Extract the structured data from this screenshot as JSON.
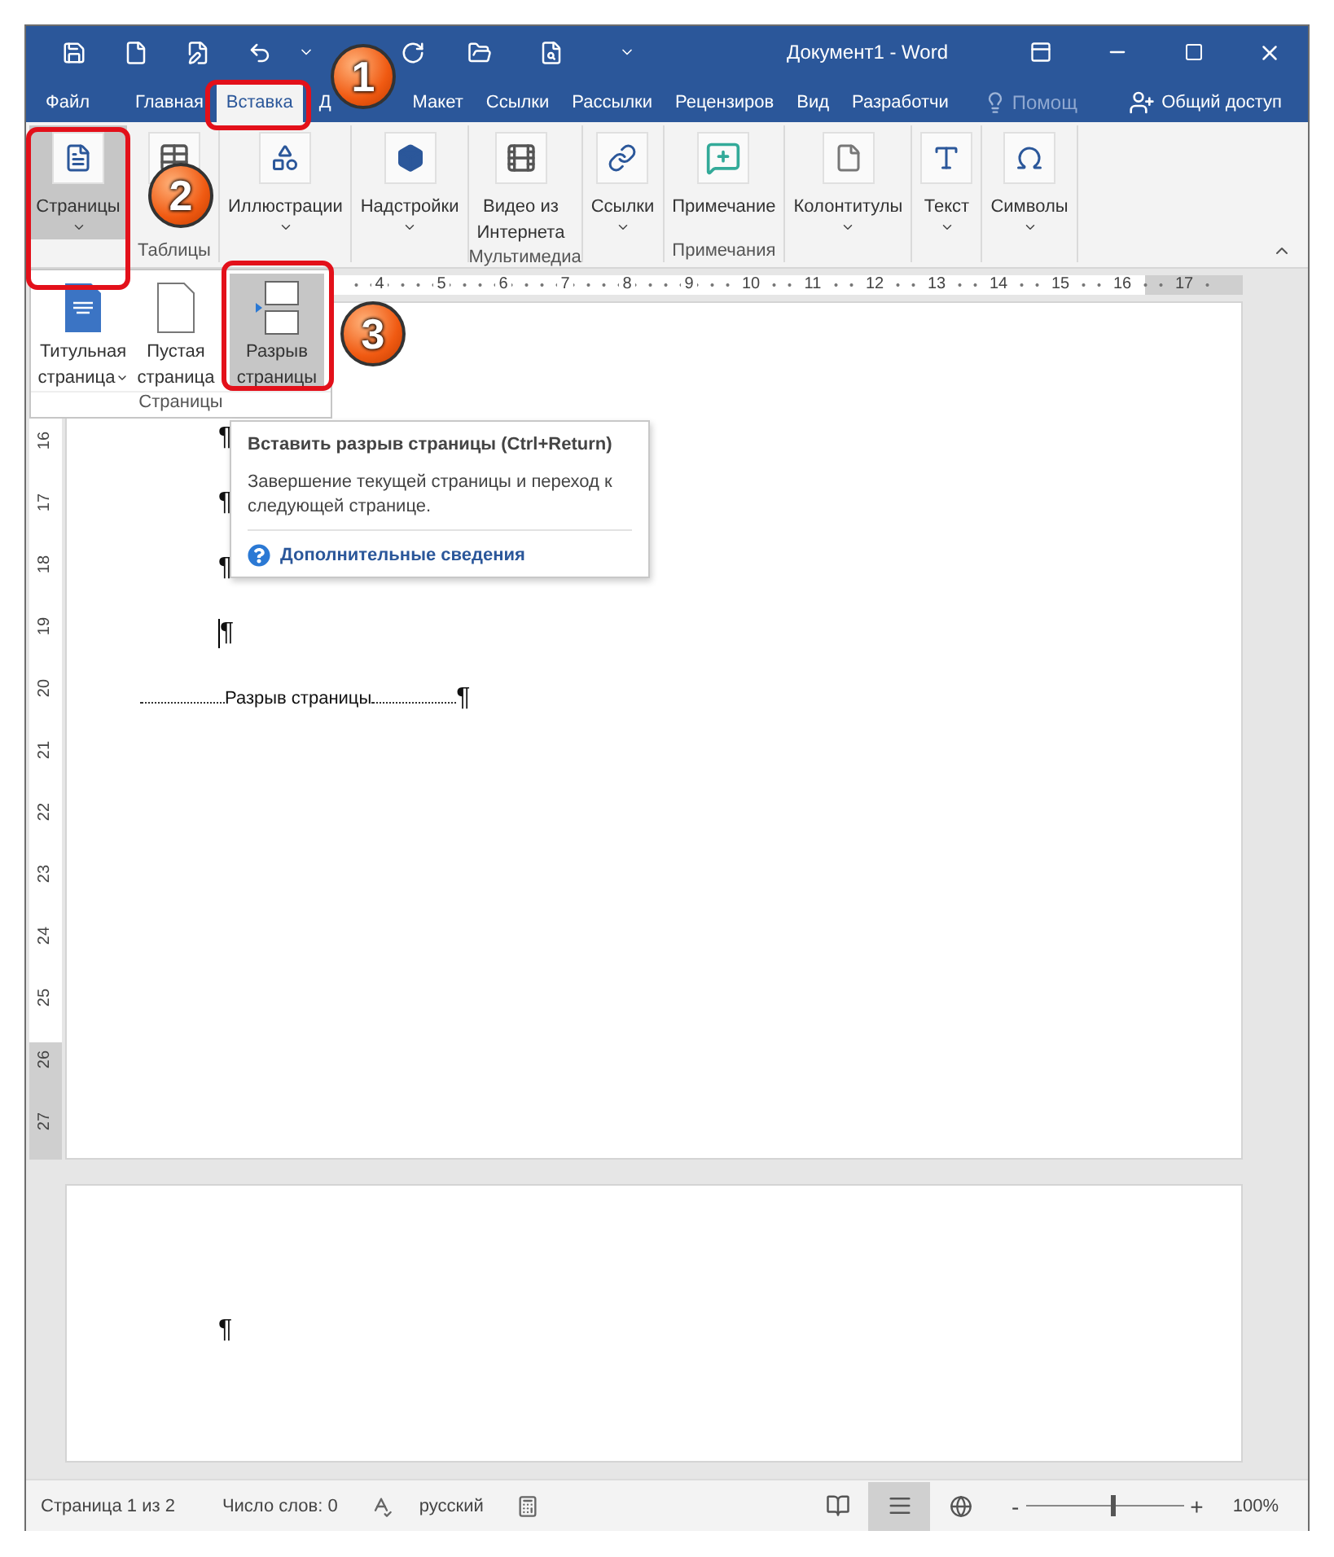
{
  "window": {
    "title": "Документ1 - Word"
  },
  "tabs": [
    {
      "label": "Файл",
      "selected": false
    },
    {
      "label": "Главная",
      "selected": false
    },
    {
      "label": "Вставка",
      "selected": true
    },
    {
      "label": "Д",
      "selected": false
    },
    {
      "label": "Макет",
      "selected": false
    },
    {
      "label": "Ссылки",
      "selected": false
    },
    {
      "label": "Рассылки",
      "selected": false
    },
    {
      "label": "Рецензиров",
      "selected": false
    },
    {
      "label": "Вид",
      "selected": false
    },
    {
      "label": "Разработчи",
      "selected": false
    }
  ],
  "tell_me": {
    "placeholder": "Помощ"
  },
  "share_button": {
    "label": "Общий доступ"
  },
  "ribbon": {
    "groups": [
      {
        "buttons": [
          {
            "kind": "pages",
            "lines": [
              "Страницы"
            ],
            "dropdown": true,
            "pressed": true
          }
        ]
      },
      {
        "label": "Таблицы",
        "buttons": [
          {
            "kind": "table",
            "dropdown": false,
            "pressed": false
          }
        ]
      },
      {
        "buttons": [
          {
            "kind": "illustrations",
            "lines": [
              "Иллюстрации"
            ],
            "dropdown": true,
            "pressed": false
          }
        ]
      },
      {
        "buttons": [
          {
            "kind": "addins",
            "lines": [
              "Надстройки"
            ],
            "dropdown": true,
            "pressed": false
          }
        ]
      },
      {
        "label": "Мультимедиа",
        "buttons": [
          {
            "kind": "video",
            "lines": [
              "Видео из",
              "Интернета"
            ],
            "dropdown": false,
            "pressed": false
          }
        ]
      },
      {
        "buttons": [
          {
            "kind": "links",
            "lines": [
              "Ссылки"
            ],
            "dropdown": true,
            "pressed": false
          }
        ]
      },
      {
        "label": "Примечания",
        "buttons": [
          {
            "kind": "comment",
            "lines": [
              "Примечание"
            ],
            "dropdown": false,
            "pressed": false
          }
        ]
      },
      {
        "buttons": [
          {
            "kind": "header",
            "lines": [
              "Колонтитулы"
            ],
            "dropdown": true,
            "pressed": false
          }
        ]
      },
      {
        "buttons": [
          {
            "kind": "text",
            "lines": [
              "Текст"
            ],
            "dropdown": true,
            "pressed": false
          }
        ]
      },
      {
        "buttons": [
          {
            "kind": "symbols",
            "lines": [
              "Символы"
            ],
            "dropdown": true,
            "pressed": false
          }
        ]
      }
    ]
  },
  "gallery": {
    "label": "Страницы",
    "items": [
      {
        "kind": "cover",
        "lines": [
          "Титульная",
          "страница"
        ],
        "dropdown": true,
        "selected": false
      },
      {
        "kind": "blank",
        "lines": [
          "Пустая",
          "страница"
        ],
        "dropdown": false,
        "selected": false
      },
      {
        "kind": "break",
        "lines": [
          "Разрыв",
          "страницы"
        ],
        "dropdown": false,
        "selected": true
      }
    ]
  },
  "tooltip": {
    "title": "Вставить разрыв страницы (Ctrl+Return)",
    "body": "Завершение текущей страницы и переход к следующей странице.",
    "link": "Дополнительные сведения"
  },
  "ruler": {
    "horizontal": [
      "4",
      "5",
      "6",
      "7",
      "8",
      "9",
      "10",
      "11",
      "12",
      "13",
      "14",
      "15",
      "16",
      "17"
    ],
    "vertical": [
      "16",
      "17",
      "18",
      "19",
      "20",
      "21",
      "22",
      "23",
      "24",
      "25",
      "26",
      "27"
    ]
  },
  "document": {
    "pages": [
      {
        "lines": [
          {
            "kind": "pilcrow",
            "text": "¶",
            "caret": false
          },
          {
            "kind": "pilcrow",
            "text": "¶",
            "caret": false
          },
          {
            "kind": "pilcrow",
            "text": "¶",
            "caret": false
          },
          {
            "kind": "pilcrow",
            "text": "¶",
            "caret": true
          },
          {
            "kind": "page_break",
            "text": "Разрыв страницы",
            "mark": "¶"
          }
        ]
      },
      {
        "lines": [
          {
            "kind": "pilcrow",
            "text": "¶",
            "caret": false
          }
        ]
      }
    ]
  },
  "callouts": [
    {
      "number": "1"
    },
    {
      "number": "2"
    },
    {
      "number": "3"
    }
  ],
  "status_bar": {
    "page": "Страница 1 из 2",
    "words": "Число слов: 0",
    "language": "русский",
    "views": [
      {
        "kind": "read",
        "selected": false
      },
      {
        "kind": "print",
        "selected": true
      },
      {
        "kind": "web",
        "selected": false
      }
    ],
    "zoom": {
      "minus": "-",
      "plus": "+",
      "level": 0.55,
      "reading": "100%"
    }
  }
}
